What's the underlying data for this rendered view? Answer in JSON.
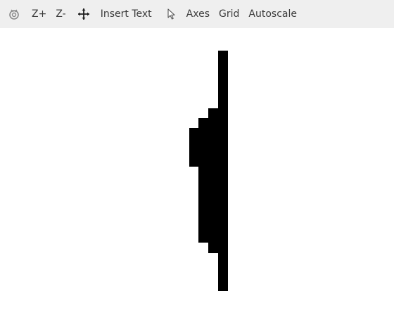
{
  "toolbar": {
    "items": [
      {
        "kind": "icon",
        "icon": "reset-view-icon"
      },
      {
        "kind": "text",
        "label": "Z+"
      },
      {
        "kind": "text",
        "label": "Z-"
      },
      {
        "kind": "icon",
        "icon": "pan-move-icon"
      },
      {
        "kind": "text",
        "label": "Insert Text"
      },
      {
        "kind": "icon",
        "icon": "select-pointer-icon"
      },
      {
        "kind": "text",
        "label": "Axes"
      },
      {
        "kind": "text",
        "label": "Grid"
      },
      {
        "kind": "text",
        "label": "Autoscale"
      }
    ]
  },
  "canvas": {
    "background": "#ffffff",
    "shape_color": "#000000"
  }
}
